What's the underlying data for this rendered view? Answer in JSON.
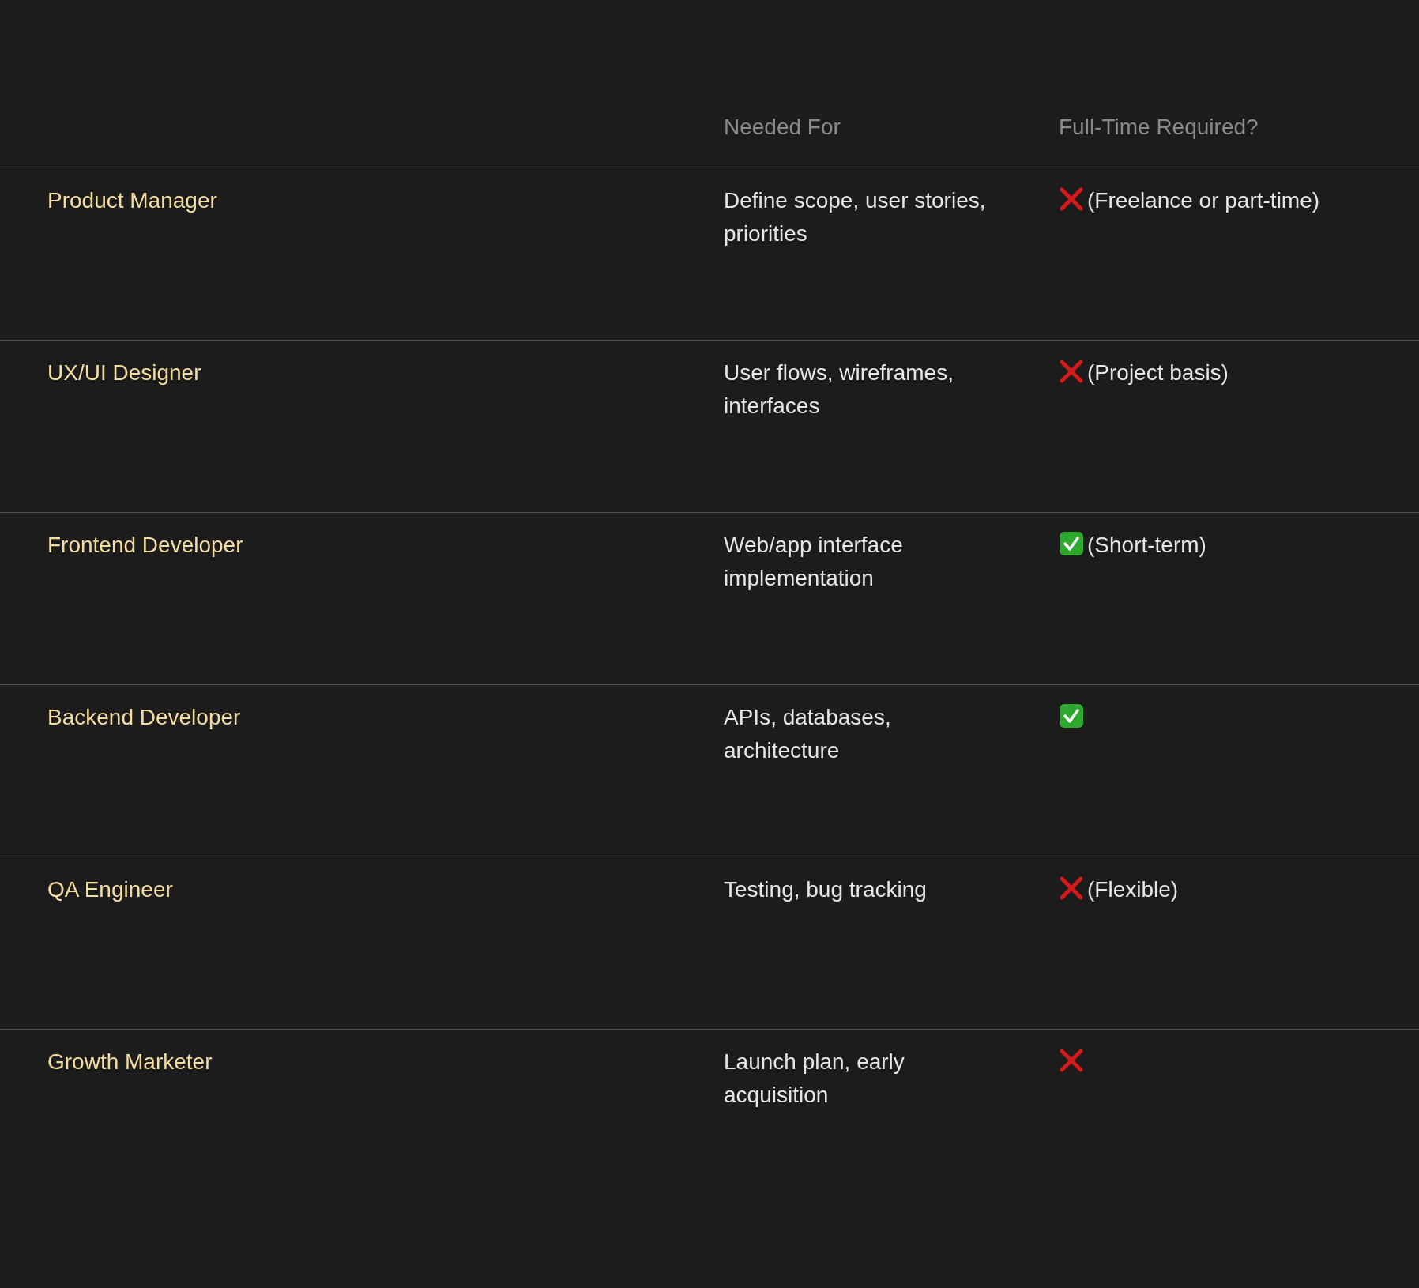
{
  "table": {
    "columns": [
      {
        "label": "Needed For"
      },
      {
        "label": "Full-Time Required?"
      }
    ],
    "rows": [
      {
        "role": "Product Manager",
        "needed_for": "Define scope, user stories, priorities",
        "full_time": false,
        "note": "(Freelance or part-time)"
      },
      {
        "role": "UX/UI Designer",
        "needed_for": "User flows, wireframes, interfaces",
        "full_time": false,
        "note": "(Project basis)"
      },
      {
        "role": "Frontend Developer",
        "needed_for": "Web/app interface implementation",
        "full_time": true,
        "note": "(Short-term)"
      },
      {
        "role": "Backend Developer",
        "needed_for": "APIs, databases, architecture",
        "full_time": true
      },
      {
        "role": "QA Engineer",
        "needed_for": "Testing, bug tracking",
        "full_time": false,
        "note": "(Flexible)"
      },
      {
        "role": "Growth Marketer",
        "needed_for": "Launch plan, early acquisition",
        "full_time": false
      }
    ]
  }
}
